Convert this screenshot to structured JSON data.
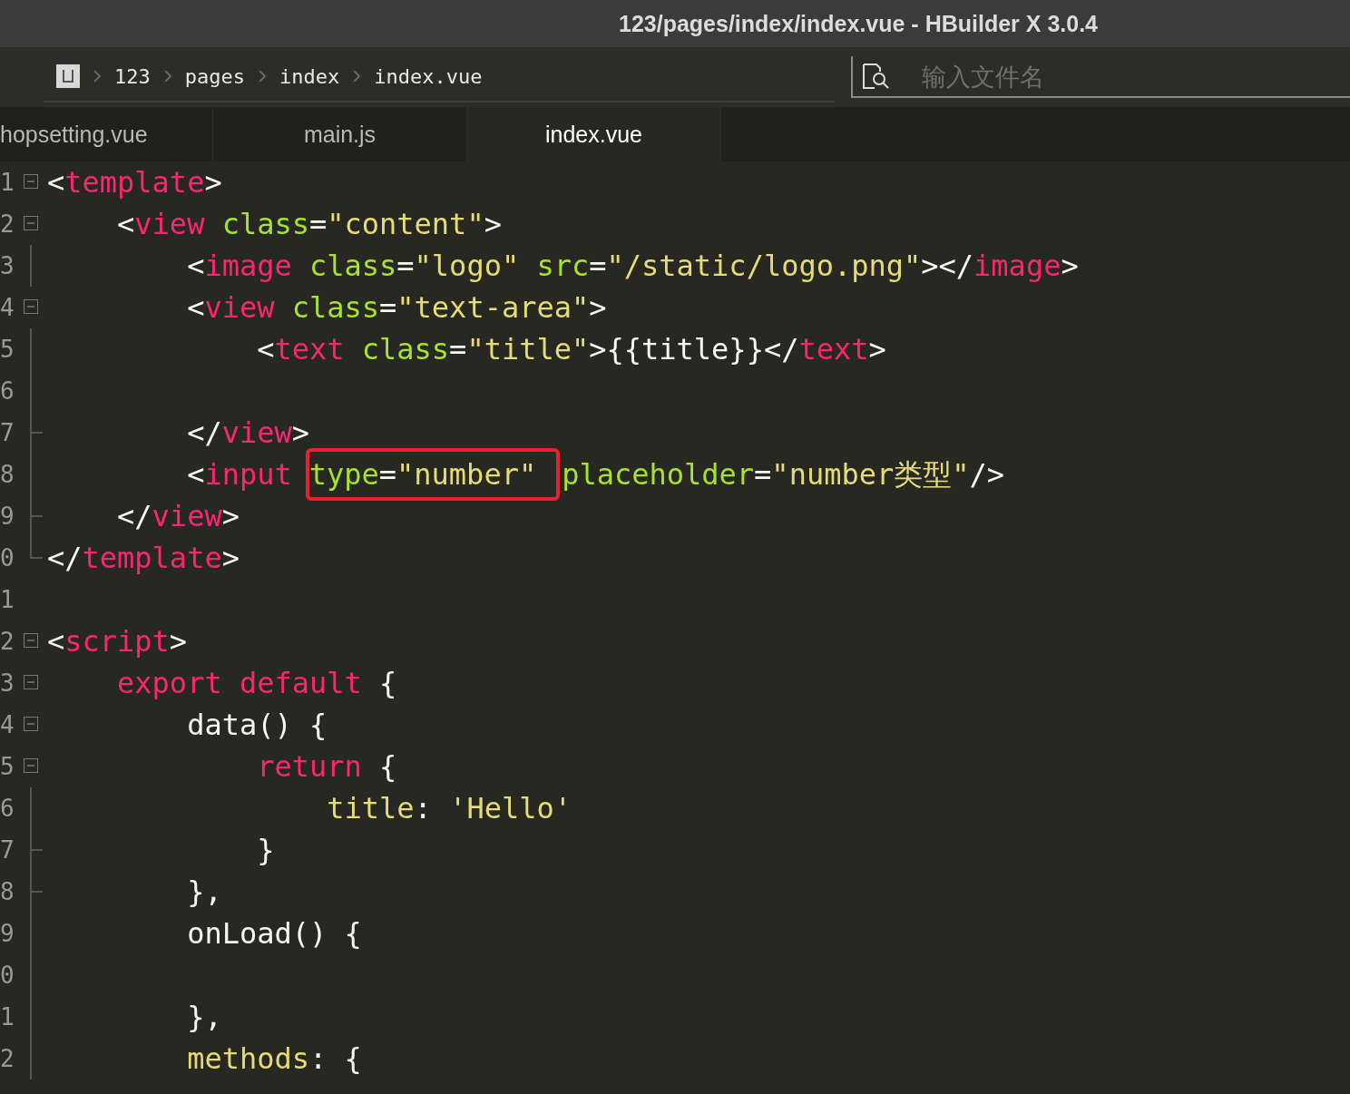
{
  "window": {
    "title": "123/pages/index/index.vue - HBuilder X 3.0.4"
  },
  "breadcrumb": [
    "123",
    "pages",
    "index",
    "index.vue"
  ],
  "search": {
    "placeholder": "输入文件名"
  },
  "tabs": [
    {
      "label": "hopsetting.vue",
      "selected": false
    },
    {
      "label": "main.js",
      "selected": false
    },
    {
      "label": "index.vue",
      "selected": true
    }
  ],
  "editor": {
    "lines": [
      {
        "number": "1",
        "kind": "open",
        "tokens": [
          {
            "kind": "plain",
            "text": "<"
          },
          {
            "kind": "tag",
            "text": "template"
          },
          {
            "kind": "plain",
            "text": ">"
          }
        ]
      },
      {
        "number": "2",
        "kind": "open",
        "tokens": [
          {
            "kind": "plain",
            "text": "    <"
          },
          {
            "kind": "tag",
            "text": "view"
          },
          {
            "kind": "attr",
            "text": " class"
          },
          {
            "kind": "plain",
            "text": "="
          },
          {
            "kind": "string",
            "text": "\"content\""
          },
          {
            "kind": "plain",
            "text": ">"
          }
        ]
      },
      {
        "number": "3",
        "kind": "inner",
        "tokens": [
          {
            "kind": "plain",
            "text": "        <"
          },
          {
            "kind": "tag",
            "text": "image"
          },
          {
            "kind": "attr",
            "text": " class"
          },
          {
            "kind": "plain",
            "text": "="
          },
          {
            "kind": "string",
            "text": "\"logo\""
          },
          {
            "kind": "attr",
            "text": " src"
          },
          {
            "kind": "plain",
            "text": "="
          },
          {
            "kind": "string",
            "text": "\"/static/logo.png\""
          },
          {
            "kind": "plain",
            "text": "></"
          },
          {
            "kind": "tag",
            "text": "image"
          },
          {
            "kind": "plain",
            "text": ">"
          }
        ]
      },
      {
        "number": "4",
        "kind": "open",
        "tokens": [
          {
            "kind": "plain",
            "text": "        <"
          },
          {
            "kind": "tag",
            "text": "view"
          },
          {
            "kind": "attr",
            "text": " class"
          },
          {
            "kind": "plain",
            "text": "="
          },
          {
            "kind": "string",
            "text": "\"text-area\""
          },
          {
            "kind": "plain",
            "text": ">"
          }
        ]
      },
      {
        "number": "5",
        "kind": "inner",
        "tokens": [
          {
            "kind": "plain",
            "text": "            <"
          },
          {
            "kind": "tag",
            "text": "text"
          },
          {
            "kind": "attr",
            "text": " class"
          },
          {
            "kind": "plain",
            "text": "="
          },
          {
            "kind": "string",
            "text": "\"title\""
          },
          {
            "kind": "plain",
            "text": ">{{title}}</"
          },
          {
            "kind": "tag",
            "text": "text"
          },
          {
            "kind": "plain",
            "text": ">"
          }
        ]
      },
      {
        "number": "6",
        "kind": "inner"
      },
      {
        "number": "7",
        "kind": "end",
        "tokens": [
          {
            "kind": "plain",
            "text": "        </"
          },
          {
            "kind": "tag",
            "text": "view"
          },
          {
            "kind": "plain",
            "text": ">"
          }
        ]
      },
      {
        "number": "8",
        "kind": "inner",
        "tokens": [
          {
            "kind": "plain",
            "text": "        <"
          },
          {
            "kind": "tag",
            "text": "input"
          },
          {
            "kind": "boxed",
            "tokens": [
              {
                "kind": "attr",
                "text": "type"
              },
              {
                "kind": "plain",
                "text": "="
              },
              {
                "kind": "string",
                "text": "\"number\""
              }
            ]
          },
          {
            "kind": "attr",
            "text": "placeholder"
          },
          {
            "kind": "plain",
            "text": "="
          },
          {
            "kind": "string",
            "text": "\"number类型\""
          },
          {
            "kind": "plain",
            "text": "/>"
          }
        ]
      },
      {
        "number": "9",
        "kind": "end",
        "tokens": [
          {
            "kind": "plain",
            "text": "    </"
          },
          {
            "kind": "tag",
            "text": "view"
          },
          {
            "kind": "plain",
            "text": ">"
          }
        ]
      },
      {
        "number": "0",
        "kind": "last",
        "tokens": [
          {
            "kind": "plain",
            "text": "</"
          },
          {
            "kind": "tag",
            "text": "template"
          },
          {
            "kind": "plain",
            "text": ">"
          }
        ]
      },
      {
        "number": "1",
        "kind": "blank"
      },
      {
        "number": "2",
        "kind": "open",
        "tokens": [
          {
            "kind": "plain",
            "text": "<"
          },
          {
            "kind": "tag",
            "text": "script"
          },
          {
            "kind": "plain",
            "text": ">"
          }
        ]
      },
      {
        "number": "3",
        "kind": "open",
        "tokens": [
          {
            "kind": "tag",
            "text": "    export default"
          },
          {
            "kind": "plain",
            "text": " {"
          }
        ]
      },
      {
        "number": "4",
        "kind": "open",
        "tokens": [
          {
            "kind": "plain",
            "text": "        data() {"
          }
        ]
      },
      {
        "number": "5",
        "kind": "open",
        "tokens": [
          {
            "kind": "tag",
            "text": "            return"
          },
          {
            "kind": "plain",
            "text": " {"
          }
        ]
      },
      {
        "number": "6",
        "kind": "inner",
        "tokens": [
          {
            "kind": "string",
            "text": "                title"
          },
          {
            "kind": "plain",
            "text": ": "
          },
          {
            "kind": "string",
            "text": "'Hello'"
          }
        ]
      },
      {
        "number": "7",
        "kind": "end",
        "tokens": [
          {
            "kind": "plain",
            "text": "            }"
          }
        ]
      },
      {
        "number": "8",
        "kind": "end",
        "tokens": [
          {
            "kind": "plain",
            "text": "        },"
          }
        ]
      },
      {
        "number": "9",
        "kind": "inner",
        "tokens": [
          {
            "kind": "plain",
            "text": "        onLoad() {"
          }
        ]
      },
      {
        "number": "0",
        "kind": "inner"
      },
      {
        "number": "1",
        "kind": "inner",
        "tokens": [
          {
            "kind": "plain",
            "text": "        },"
          }
        ]
      },
      {
        "number": "2",
        "kind": "inner",
        "tokens": [
          {
            "kind": "string",
            "text": "        methods"
          },
          {
            "kind": "plain",
            "text": ": {"
          }
        ]
      }
    ]
  }
}
